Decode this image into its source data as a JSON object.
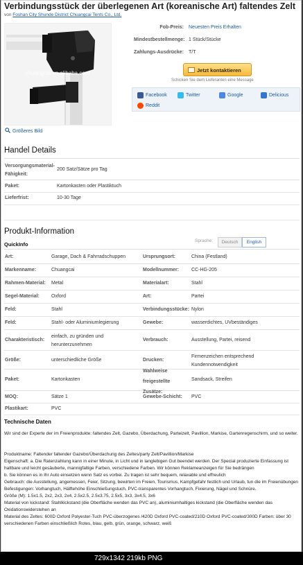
{
  "header": {
    "title": "Verbindungsstück der überlegenen Art (koreanische Art) faltendes Zelt",
    "by_prefix": "von",
    "supplier": "Foshan City Shunde District Chuangcai Tents Co., Ltd."
  },
  "image": {
    "watermark": "chuangcai.en.alibaba.com",
    "bigger_label": "Größeres Bild"
  },
  "offer": {
    "fob_label": "Fob-Preis:",
    "fob_value": "Neuesten Preis Erhalten",
    "moq_label": "Mindestbestellmenge:",
    "moq_value": "1 Stück/Stücke",
    "pay_label": "Zahlungs-Ausdrücke:",
    "pay_value": "T/T",
    "contact_button": "Jetzt kontaktieren",
    "send_message": "Schicken Sie dem Lieferanten eine Message"
  },
  "share": [
    "Facebook",
    "Twitter",
    "Google",
    "Delicious",
    "Reddit"
  ],
  "handel": {
    "heading": "Handel Details",
    "rows": [
      {
        "label": "Versorgungsmaterial-Fähigkeit:",
        "value": "200 Satz/Sätze pro Tag"
      },
      {
        "label": "Paket:",
        "value": "Kartonkasten oder Plastiktuch"
      },
      {
        "label": "Lieferfrist:",
        "value": "10-30 Tage"
      }
    ]
  },
  "produkt": {
    "heading": "Produkt-Information",
    "quickinfo": "QuickInfo",
    "lang_label": "Sprache:",
    "lang_de": "Deutsch",
    "lang_en": "English",
    "rows": [
      {
        "l1": "Art:",
        "v1": "Garage, Dach & Fahrradschuppen",
        "l2": "Ursprungsort:",
        "v2": "China (Festland)"
      },
      {
        "l1": "Markenname:",
        "v1": "Chuangcai",
        "l2": "Modellnummer:",
        "v2": "CC-HG-205"
      },
      {
        "l1": "Rahmen-Material:",
        "v1": "Metal",
        "l2": "Materialart:",
        "v2": "Stahl"
      },
      {
        "l1": "Segel-Material:",
        "v1": "Oxford",
        "l2": "Art:",
        "v2": "Partei"
      },
      {
        "l1": "Feld:",
        "v1": "Stahl",
        "l2": "Verbindungsstücke:",
        "v2": "Nylon"
      },
      {
        "l1": "Feld:",
        "v1": "Stahl- oder Aluminiumlegierung",
        "l2": "Gewebe:",
        "v2": "wasserdichtes, UVbeständiges"
      },
      {
        "l1": "Charakteristisch:",
        "v1": "einfach, zu gründen und herunterzunehmen",
        "l2": "Verbrauch:",
        "v2": "Ausstellung, Partei, reisend"
      },
      {
        "l1": "Größe:",
        "v1": "unterschiedliche Größe",
        "l2": "Drucken:",
        "v2": "Firmenzeichen entsprechend Kundennotwendigkeit"
      },
      {
        "l1": "Paket:",
        "v1": "Kartonkasten",
        "l2": "Wahlweise freigestellte Zusätze:",
        "v2": "Sandsack, Streifen"
      },
      {
        "l1": "MOQ:",
        "v1": "Sätze 1",
        "l2": "Gewebe-Schicht:",
        "v2": "PVC"
      },
      {
        "l1": "Plastikart:",
        "v1": "PVC",
        "l2": "",
        "v2": ""
      }
    ]
  },
  "technische": {
    "heading": "Technische Daten",
    "intro": "Wir sind der Experte der im Freienprodukte: faltendes Zelt, Gazebo, Überdachung, Parteizelt, Pavillion, Markise, Gartenregenschirm, und so weiter.",
    "body": "Produktname: Faltender faltender Gazebo/Überdachung des Zeltes/party Zelt/Pavillion/Markise\nEigenschaft: a. Die Ratenzahlung kann in einer Minute, in Licht und in langlebigen Gut beendet werden. Der Special produzierte Einfassung ist haltbare und leicht gesäuberte, mannigfaltige Farben, verschiedene Farben. Wir können Reklameanzeigen für Sie bedrängen\nb. Sie können es in Ihr Auto einsetzen wenn Satz es vorbei. Zu tragen ist sehr bequem, relaxable und effreulich\nGebrauch: die Ausstellung, angemessen, Feier, Sitzung, bewirten im Freien, Tourismus, Kampfgefahr festlich und Urlaub, tun die im Freienübungen\nBefestigungen: Vorhangtuch, Hälftehöhe Einschließungstuch, PVC-transparentes Vorhangtuch, Fixierung, Nägel und Schnüre.\nGröße (M): 1.5x1.5, 2x2, 2x3, 2x4, 2.5x2.5, 2.5x3.75, 2.5x5, 3x3, 3x4.5, 3x6\nMaterial von kickstand: Stahlkickstand (die Oberfläche wenden das PVC an), aluminiumhaltiges kickstand (die Oberfläche wenden das Oxidationswiderstehen an\nMaterial des Zeltes: 600D Oxford Polyester-Tuch PVC-überzogenes /420D Oxford PVC-coated/210D Oxford PVC-coated/300D Farben: über 30 verschiedenen Farben einschließlich Rotes, blau, gelb, grün, orange, schwarz, weiß"
  },
  "statusbar": "729x1342  219kb  PNG",
  "colors": {
    "link": "#1a5aa6",
    "button": "#f6b93b"
  }
}
